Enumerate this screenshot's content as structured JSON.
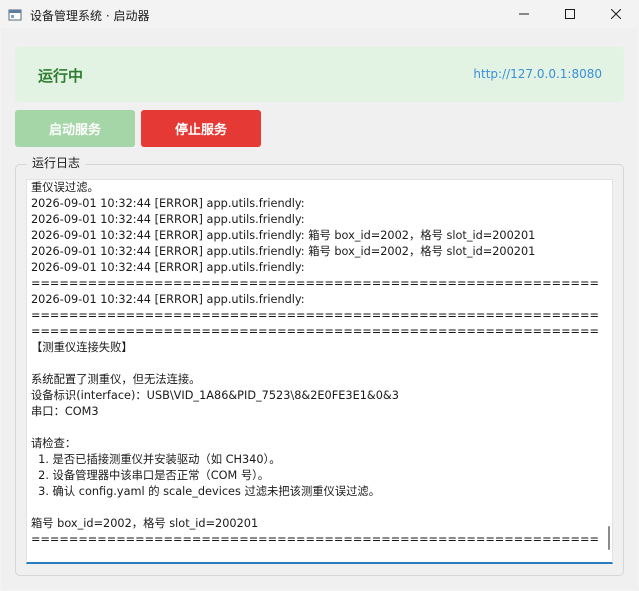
{
  "window": {
    "title": "设备管理系统 · 启动器"
  },
  "status": {
    "text": "运行中",
    "url": "http://127.0.0.1:8080"
  },
  "buttons": {
    "start_label": "启动服务",
    "stop_label": "停止服务"
  },
  "log": {
    "group_label": "运行日志",
    "lines": [
      "重仪误过滤。",
      "2026-09-01 10:32:44 [ERROR] app.utils.friendly:",
      "2026-09-01 10:32:44 [ERROR] app.utils.friendly:",
      "2026-09-01 10:32:44 [ERROR] app.utils.friendly: 箱号 box_id=2002，格号 slot_id=200201",
      "2026-09-01 10:32:44 [ERROR] app.utils.friendly: 箱号 box_id=2002，格号 slot_id=200201",
      "2026-09-01 10:32:44 [ERROR] app.utils.friendly:",
      "============================================================",
      "2026-09-01 10:32:44 [ERROR] app.utils.friendly:",
      "============================================================",
      "============================================================",
      "【测重仪连接失败】",
      "",
      "系统配置了测重仪，但无法连接。",
      "设备标识(interface)：USB\\VID_1A86&PID_7523\\8&2E0FE3E1&0&3",
      "串口：COM3",
      "",
      "请检查：",
      "  1. 是否已插接测重仪并安装驱动（如 CH340）。",
      "  2. 设备管理器中该串口是否正常（COM 号）。",
      "  3. 确认 config.yaml 的 scale_devices 过滤未把该测重仪误过滤。",
      "",
      "箱号 box_id=2002，格号 slot_id=200201",
      "============================================================"
    ]
  }
}
